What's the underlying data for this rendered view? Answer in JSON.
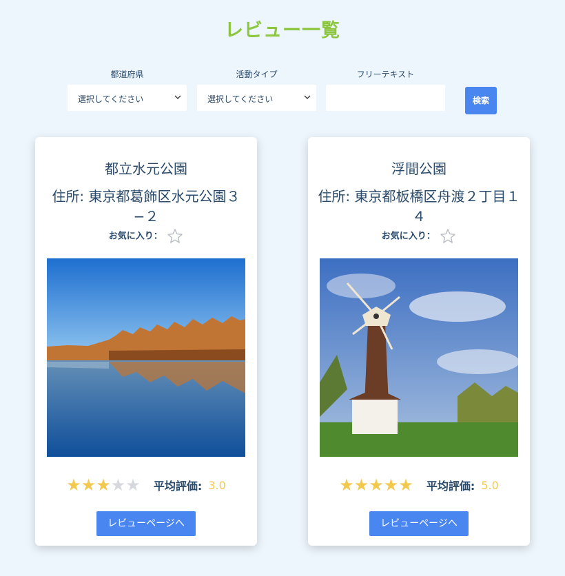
{
  "page": {
    "title": "レビュー一覧"
  },
  "filters": {
    "prefecture": {
      "label": "都道府県",
      "value": "選択してください"
    },
    "activity": {
      "label": "活動タイプ",
      "value": "選択してください"
    },
    "freetext": {
      "label": "フリーテキスト",
      "value": ""
    },
    "search_label": "検索"
  },
  "cards": [
    {
      "name": "都立水元公園",
      "address": "住所: 東京都葛飾区水元公園３−２",
      "favorite_label": "お気に入り：",
      "stars": "★★★",
      "stars_off": "★★",
      "rating": 3,
      "avg_label": "平均評価:",
      "avg_value": "3.0",
      "button_label": "レビューページへ"
    },
    {
      "name": "浮間公園",
      "address": "住所: 東京都板橋区舟渡２丁目１４",
      "favorite_label": "お気に入り：",
      "stars": "★★★★★",
      "stars_off": "",
      "rating": 5,
      "avg_label": "平均評価:",
      "avg_value": "5.0",
      "button_label": "レビューページへ"
    }
  ],
  "colors": {
    "accent": "#8cc63f",
    "primary": "#4a86f0",
    "star": "#f2c94c",
    "text": "#2a4a6b"
  }
}
